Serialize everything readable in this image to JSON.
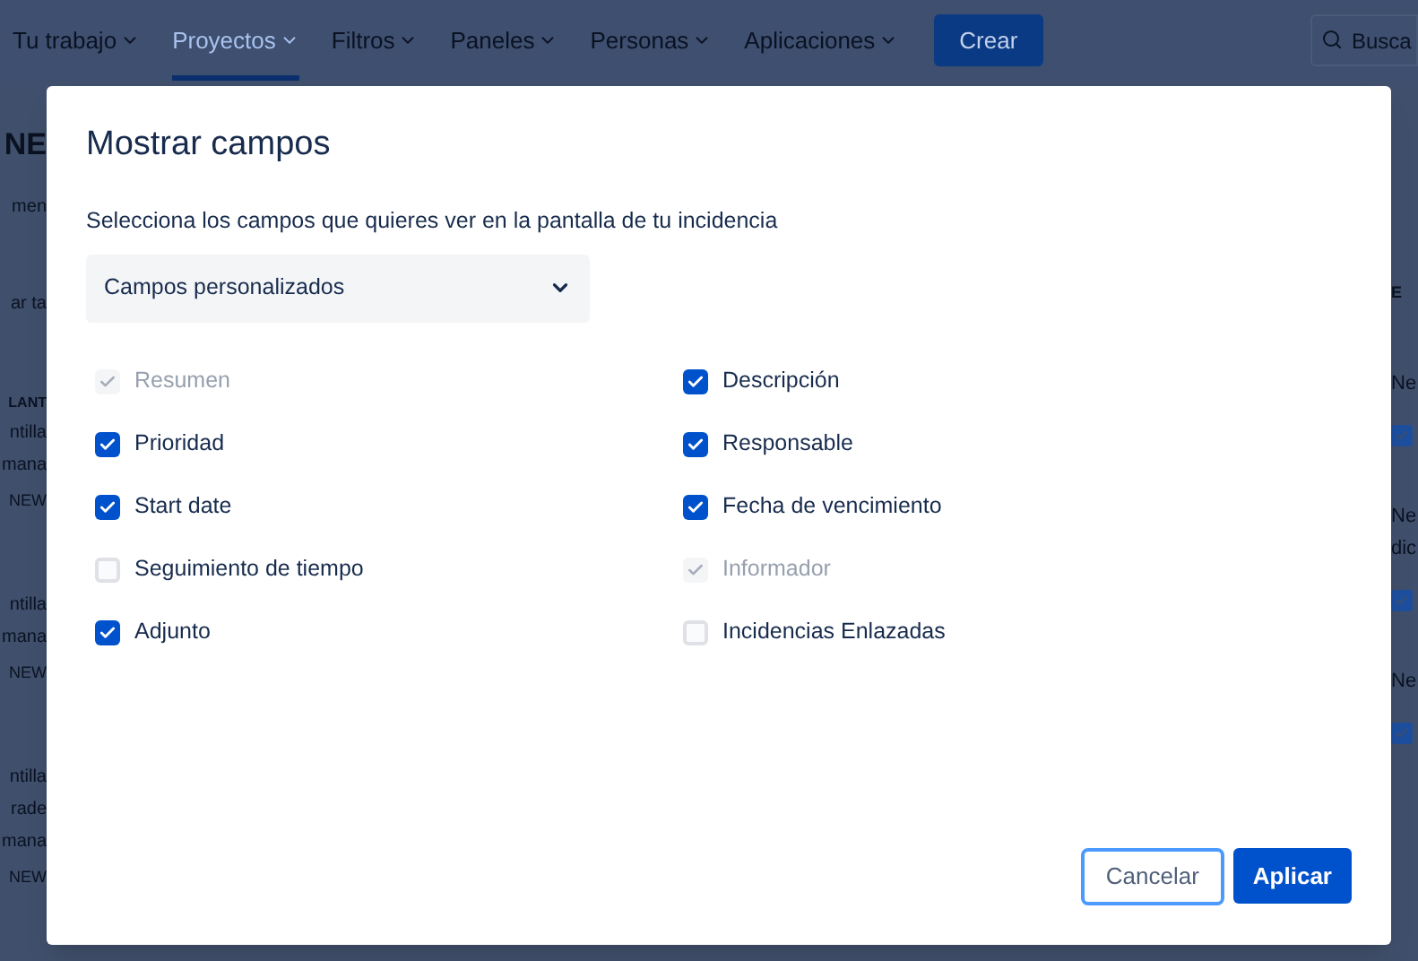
{
  "nav": {
    "items": [
      {
        "label": "Tu trabajo",
        "selected": false
      },
      {
        "label": "Proyectos",
        "selected": true
      },
      {
        "label": "Filtros",
        "selected": false
      },
      {
        "label": "Paneles",
        "selected": false
      },
      {
        "label": "Personas",
        "selected": false
      },
      {
        "label": "Aplicaciones",
        "selected": false
      }
    ],
    "create": "Crear",
    "search": {
      "placeholder": "Busca"
    }
  },
  "background_left": [
    {
      "kind": "heading",
      "text": "NE"
    },
    {
      "kind": "tab",
      "text": "men"
    },
    {
      "kind": "input",
      "text": "ar ta"
    },
    {
      "kind": "header",
      "text": "LANT"
    },
    {
      "kind": "title",
      "text": "ntilla"
    },
    {
      "kind": "title",
      "text": "mana"
    },
    {
      "kind": "status",
      "text": "NEW"
    },
    {
      "kind": "title",
      "text": "ntilla"
    },
    {
      "kind": "title",
      "text": "mana"
    },
    {
      "kind": "status",
      "text": "NEW"
    },
    {
      "kind": "title",
      "text": "ntilla"
    },
    {
      "kind": "title",
      "text": "rade"
    },
    {
      "kind": "title",
      "text": "mana"
    },
    {
      "kind": "status",
      "text": "NEW"
    }
  ],
  "background_right": [
    {
      "kind": "header",
      "text": "E"
    },
    {
      "kind": "title",
      "text": "Ne"
    },
    {
      "kind": "checkbox",
      "checked": true
    },
    {
      "kind": "title",
      "text": "Ne"
    },
    {
      "kind": "title",
      "text": "dic"
    },
    {
      "kind": "checkbox",
      "checked": true
    },
    {
      "kind": "title",
      "text": "Ne"
    },
    {
      "kind": "checkbox",
      "checked": true
    }
  ],
  "modal": {
    "title": "Mostrar campos",
    "description": "Selecciona los campos que quieres ver en la pantalla de tu incidencia",
    "dropdown": {
      "value": "Campos personalizados"
    },
    "columns": [
      [
        {
          "label": "Resumen",
          "checked": true,
          "disabled": true
        },
        {
          "label": "Prioridad",
          "checked": true,
          "disabled": false
        },
        {
          "label": "Start date",
          "checked": true,
          "disabled": false
        },
        {
          "label": "Seguimiento de tiempo",
          "checked": false,
          "disabled": false
        },
        {
          "label": "Adjunto",
          "checked": true,
          "disabled": false
        }
      ],
      [
        {
          "label": "Descripción",
          "checked": true,
          "disabled": false
        },
        {
          "label": "Responsable",
          "checked": true,
          "disabled": false
        },
        {
          "label": "Fecha de vencimiento",
          "checked": true,
          "disabled": false
        },
        {
          "label": "Informador",
          "checked": true,
          "disabled": true
        },
        {
          "label": "Incidencias Enlazadas",
          "checked": false,
          "disabled": false
        }
      ]
    ],
    "buttons": [
      {
        "kind": "secondary",
        "label": "Cancelar"
      },
      {
        "kind": "primary",
        "label": "Aplicar"
      }
    ]
  }
}
